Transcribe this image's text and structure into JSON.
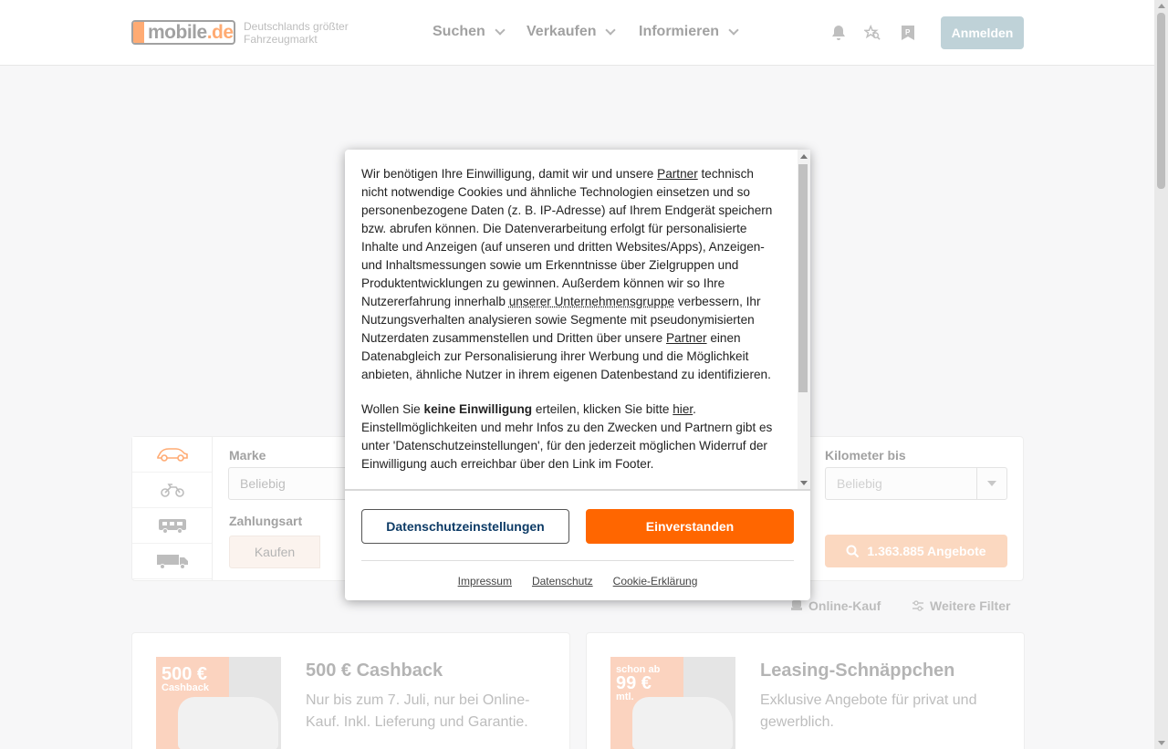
{
  "header": {
    "logo_text": "mobile",
    "logo_dot": ".de",
    "tagline": "Deutschlands größter Fahrzeugmarkt",
    "nav": [
      {
        "label": "Suchen"
      },
      {
        "label": "Verkaufen"
      },
      {
        "label": "Informieren"
      }
    ],
    "icons": [
      "bell-icon",
      "star-search-icon",
      "parking-icon"
    ],
    "login_label": "Anmelden"
  },
  "search": {
    "vehicle_tabs": [
      "car-icon",
      "motorcycle-icon",
      "camper-icon",
      "truck-icon"
    ],
    "make_label": "Marke",
    "make_value": "Beliebig",
    "payment_label": "Zahlungsart",
    "payment_option": "Kaufen",
    "km_label": "Kilometer bis",
    "km_value": "Beliebig",
    "offers_button": "1.363.885 Angebote",
    "online_purchase": "Online-Kauf",
    "more_filters": "Weitere Filter"
  },
  "promos": [
    {
      "badge_big": "500 €",
      "badge_small": "Cashback",
      "title": "500 € Cashback",
      "text": "Nur bis zum 7. Juli, nur bei Online-Kauf. Inkl. Lieferung und Garantie."
    },
    {
      "badge_top": "schon ab",
      "badge_big": "99 €",
      "badge_small": "mtl.",
      "title": "Leasing-Schnäppchen",
      "text": "Exklusive Angebote für privat und gewerblich."
    }
  ],
  "consent": {
    "p1_a": "Wir benötigen Ihre Einwilligung, damit wir und unsere ",
    "p1_link1": "Partner",
    "p1_b": " technisch nicht notwendige Cookies und ähnliche Technologien einsetzen und so personenbezogene Daten (z. B. IP-Adresse) auf Ihrem Endgerät speichern bzw. abrufen können. Die Datenverarbeitung erfolgt für personalisierte Inhalte und Anzeigen (auf unseren und dritten Websites/Apps), Anzeigen- und Inhaltsmessungen sowie um Erkenntnisse über Zielgruppen und Produktentwicklungen zu gewinnen. Außerdem können wir so Ihre Nutzererfahrung innerhalb ",
    "p1_link2": "unserer Unternehmensgruppe",
    "p1_c": " verbessern, Ihr Nutzungsverhalten analysieren sowie Segmente mit pseudonymisierten Nutzerdaten zusammenstellen und Dritten über unsere ",
    "p1_link3": "Partner",
    "p1_d": " einen Datenabgleich zur Personalisierung ihrer Werbung und die Möglichkeit anbieten, ähnliche Nutzer in ihrem eigenen Datenbestand zu identifizieren.",
    "p2_a": "Wollen Sie ",
    "p2_bold": "keine Einwilligung",
    "p2_b": " erteilen, klicken Sie bitte ",
    "p2_link": "hier",
    "p2_c": ". Einstellmöglichkeiten und mehr Infos zu den Zwecken und Partnern gibt es unter 'Datenschutzeinstellungen', für den jederzeit möglichen Widerruf der Einwilligung auch erreichbar über den Link im Footer.",
    "settings_button": "Datenschutzeinstellungen",
    "accept_button": "Einverstanden",
    "links": [
      "Impressum",
      "Datenschutz",
      "Cookie-Erklärung"
    ]
  }
}
